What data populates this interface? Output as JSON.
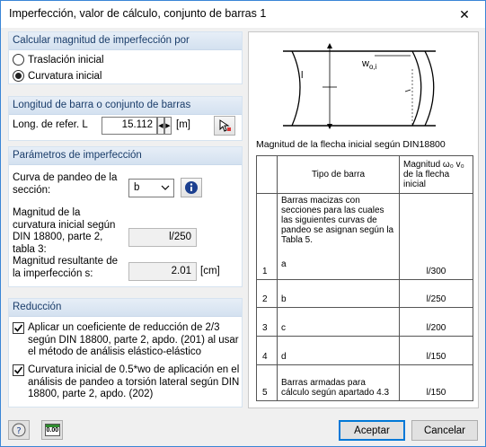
{
  "window": {
    "title": "Imperfección, valor de cálculo, conjunto de barras 1",
    "close_glyph": "✕"
  },
  "sections": {
    "calc": {
      "header": "Calcular magnitud de imperfección por",
      "options": [
        {
          "label": "Traslación inicial",
          "selected": false
        },
        {
          "label": "Curvatura inicial",
          "selected": true
        }
      ]
    },
    "length": {
      "header": "Longitud de barra o conjunto de barras",
      "ref_label": "Long. de refer. L",
      "ref_value": "15.112",
      "unit": "[m]",
      "pick_icon": "pick-member-icon"
    },
    "params": {
      "header": "Parámetros de imperfección",
      "curve_label": "Curva de pandeo de la sección:",
      "curve_value": "b",
      "info_icon": "info-icon",
      "curvature_label": "Magnitud de la curvatura inicial según DIN 18800, parte 2, tabla 3:",
      "curvature_value": "l/250",
      "resulting_label": "Magnitud resultante de la imperfección s:",
      "resulting_value": "2.01",
      "resulting_unit": "[cm]"
    },
    "reduction": {
      "header": "Reducción",
      "check1": {
        "label": "Aplicar un coeficiente de reducción de 2/3 según DIN 18800, parte 2, apdo. (201) al usar el método de análisis elástico-elástico",
        "checked": true
      },
      "check2": {
        "label": "Curvatura inicial de 0.5*wo de aplicación en el análisis de pandeo a torsión lateral según DIN 18800, parte 2, apdo. (202)",
        "checked": true
      }
    }
  },
  "diagram": {
    "symbol_label": "w",
    "symbol_sub": "o,i",
    "l_label": "l"
  },
  "table": {
    "caption": "Magnitud de la flecha inicial según DIN18800",
    "headers": [
      "Tipo de barra",
      "Magnitud ω₀ v₀ de la flecha inicial"
    ],
    "intro_text": "Barras macizas con secciones para las cuales las siguientes curvas de pandeo se asignan según la Tabla 5.",
    "rows": [
      {
        "num": "1",
        "type": "a",
        "value": "l/300"
      },
      {
        "num": "2",
        "type": "b",
        "value": "l/250"
      },
      {
        "num": "3",
        "type": "c",
        "value": "l/200"
      },
      {
        "num": "4",
        "type": "d",
        "value": "l/150"
      },
      {
        "num": "5",
        "type": "Barras armadas para cálculo según apartado 4.3",
        "value": "l/150"
      }
    ]
  },
  "footer": {
    "help_icon": "help-icon",
    "units_icon": "units-icon",
    "units_text": "0.00",
    "accept_label": "Aceptar",
    "cancel_label": "Cancelar"
  }
}
